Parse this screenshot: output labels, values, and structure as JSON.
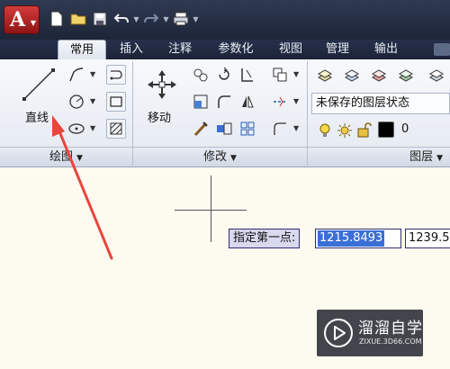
{
  "app": {
    "logo_letter": "A"
  },
  "tabs": [
    {
      "label": "常用"
    },
    {
      "label": "插入"
    },
    {
      "label": "注释"
    },
    {
      "label": "参数化"
    },
    {
      "label": "视图"
    },
    {
      "label": "管理"
    },
    {
      "label": "输出"
    }
  ],
  "panels": {
    "draw": {
      "title": "绘图",
      "line_label": "直线"
    },
    "modify": {
      "title": "修改",
      "move_label": "移动"
    },
    "layers": {
      "title": "图层",
      "layer_state": "未保存的图层状态",
      "current_layer": "0"
    }
  },
  "command": {
    "prompt": "指定第一点:",
    "x_value": "1215.8493",
    "y_value": "1239.5"
  },
  "watermark": {
    "title": "溜溜自学",
    "subtitle": "ZIXUE.3D66.COM"
  },
  "colors": {
    "annotation_arrow": "#e8453c",
    "canvas_bg": "#fdfaf0",
    "input_selection": "#3a6fd6"
  }
}
